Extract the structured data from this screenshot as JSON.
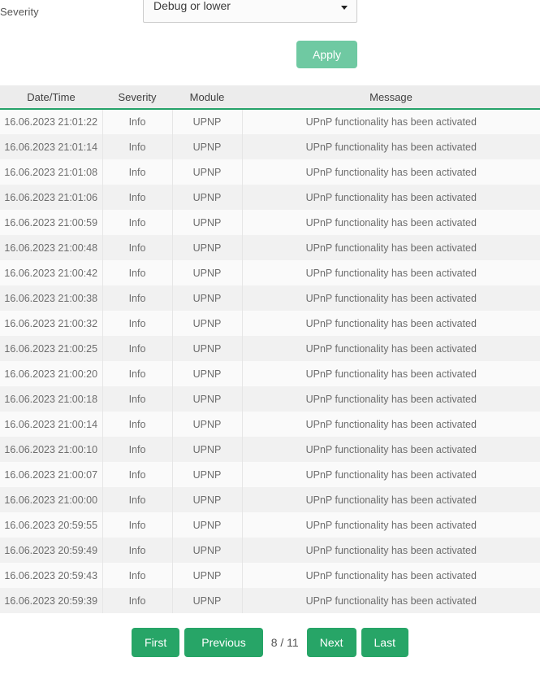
{
  "filter": {
    "label": "Severity",
    "select_value": "Debug or lower",
    "arrow_icon": "chevron-down-icon",
    "apply_label": "Apply"
  },
  "colors": {
    "accent_green": "#27a567",
    "apply_green": "#6fc9a2",
    "header_bg": "#ececec",
    "header_underline": "#26a269",
    "row_odd": "#fafafa",
    "row_even": "#f1f1f1"
  },
  "table": {
    "columns": [
      "Date/Time",
      "Severity",
      "Module",
      "Message"
    ],
    "rows": [
      {
        "datetime": "16.06.2023 21:01:22",
        "severity": "Info",
        "module": "UPNP",
        "message": "UPnP functionality has been activated"
      },
      {
        "datetime": "16.06.2023 21:01:14",
        "severity": "Info",
        "module": "UPNP",
        "message": "UPnP functionality has been activated"
      },
      {
        "datetime": "16.06.2023 21:01:08",
        "severity": "Info",
        "module": "UPNP",
        "message": "UPnP functionality has been activated"
      },
      {
        "datetime": "16.06.2023 21:01:06",
        "severity": "Info",
        "module": "UPNP",
        "message": "UPnP functionality has been activated"
      },
      {
        "datetime": "16.06.2023 21:00:59",
        "severity": "Info",
        "module": "UPNP",
        "message": "UPnP functionality has been activated"
      },
      {
        "datetime": "16.06.2023 21:00:48",
        "severity": "Info",
        "module": "UPNP",
        "message": "UPnP functionality has been activated"
      },
      {
        "datetime": "16.06.2023 21:00:42",
        "severity": "Info",
        "module": "UPNP",
        "message": "UPnP functionality has been activated"
      },
      {
        "datetime": "16.06.2023 21:00:38",
        "severity": "Info",
        "module": "UPNP",
        "message": "UPnP functionality has been activated"
      },
      {
        "datetime": "16.06.2023 21:00:32",
        "severity": "Info",
        "module": "UPNP",
        "message": "UPnP functionality has been activated"
      },
      {
        "datetime": "16.06.2023 21:00:25",
        "severity": "Info",
        "module": "UPNP",
        "message": "UPnP functionality has been activated"
      },
      {
        "datetime": "16.06.2023 21:00:20",
        "severity": "Info",
        "module": "UPNP",
        "message": "UPnP functionality has been activated"
      },
      {
        "datetime": "16.06.2023 21:00:18",
        "severity": "Info",
        "module": "UPNP",
        "message": "UPnP functionality has been activated"
      },
      {
        "datetime": "16.06.2023 21:00:14",
        "severity": "Info",
        "module": "UPNP",
        "message": "UPnP functionality has been activated"
      },
      {
        "datetime": "16.06.2023 21:00:10",
        "severity": "Info",
        "module": "UPNP",
        "message": "UPnP functionality has been activated"
      },
      {
        "datetime": "16.06.2023 21:00:07",
        "severity": "Info",
        "module": "UPNP",
        "message": "UPnP functionality has been activated"
      },
      {
        "datetime": "16.06.2023 21:00:00",
        "severity": "Info",
        "module": "UPNP",
        "message": "UPnP functionality has been activated"
      },
      {
        "datetime": "16.06.2023 20:59:55",
        "severity": "Info",
        "module": "UPNP",
        "message": "UPnP functionality has been activated"
      },
      {
        "datetime": "16.06.2023 20:59:49",
        "severity": "Info",
        "module": "UPNP",
        "message": "UPnP functionality has been activated"
      },
      {
        "datetime": "16.06.2023 20:59:43",
        "severity": "Info",
        "module": "UPNP",
        "message": "UPnP functionality has been activated"
      },
      {
        "datetime": "16.06.2023 20:59:39",
        "severity": "Info",
        "module": "UPNP",
        "message": "UPnP functionality has been activated"
      }
    ]
  },
  "pagination": {
    "first_label": "First",
    "previous_label": "Previous",
    "page_indicator": "8 / 11",
    "next_label": "Next",
    "last_label": "Last"
  }
}
